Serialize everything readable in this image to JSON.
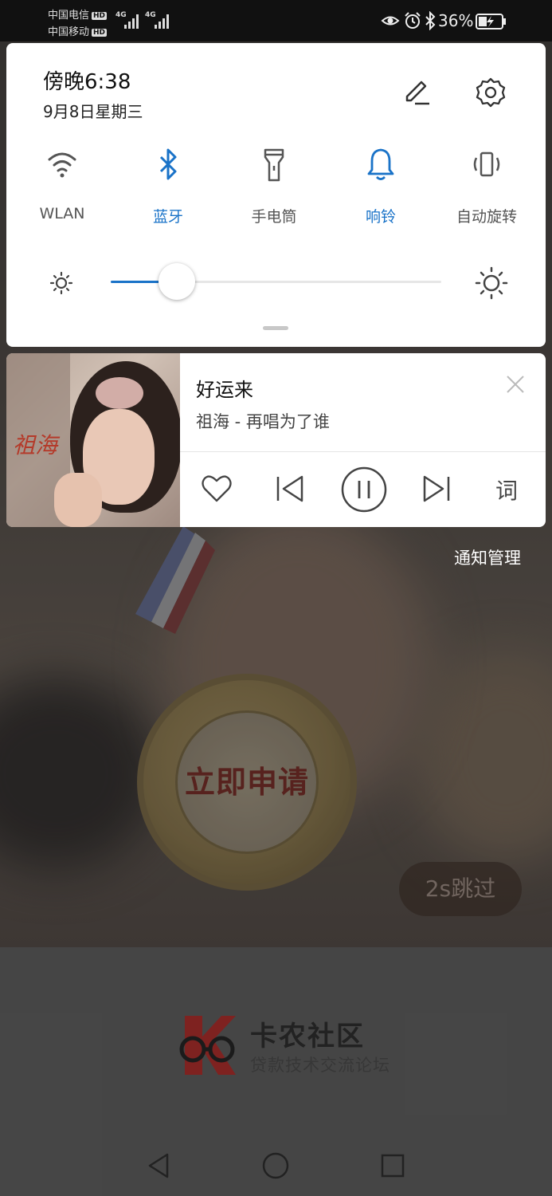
{
  "status_bar": {
    "carrier_1": "中国电信",
    "carrier_2": "中国移动",
    "hd_label": "HD",
    "network_1": "4G",
    "network_2": "4G",
    "battery_percent": "36%",
    "battery_level": 0.36
  },
  "quick_settings": {
    "time": "傍晚6:38",
    "date": "9月8日星期三",
    "tiles": [
      {
        "label": "WLAN",
        "icon": "wifi-icon",
        "active": false
      },
      {
        "label": "蓝牙",
        "icon": "bluetooth-icon",
        "active": true
      },
      {
        "label": "手电筒",
        "icon": "flashlight-icon",
        "active": false
      },
      {
        "label": "响铃",
        "icon": "bell-icon",
        "active": true
      },
      {
        "label": "自动旋转",
        "icon": "auto-rotate-icon",
        "active": false
      }
    ],
    "brightness_level": 0.2,
    "colors": {
      "accent": "#1a73c8",
      "inactive_text": "#555555"
    }
  },
  "music": {
    "title": "好运来",
    "artist_album": "祖海 - 再唱为了谁",
    "album_art_text": "祖海",
    "lyrics_label": "词"
  },
  "notification_manage": "通知管理",
  "background_app": {
    "promo_text": "立即申请",
    "skip_label": "2s跳过",
    "brand_name": "卡农社区",
    "brand_tagline": "贷款技术交流论坛"
  }
}
